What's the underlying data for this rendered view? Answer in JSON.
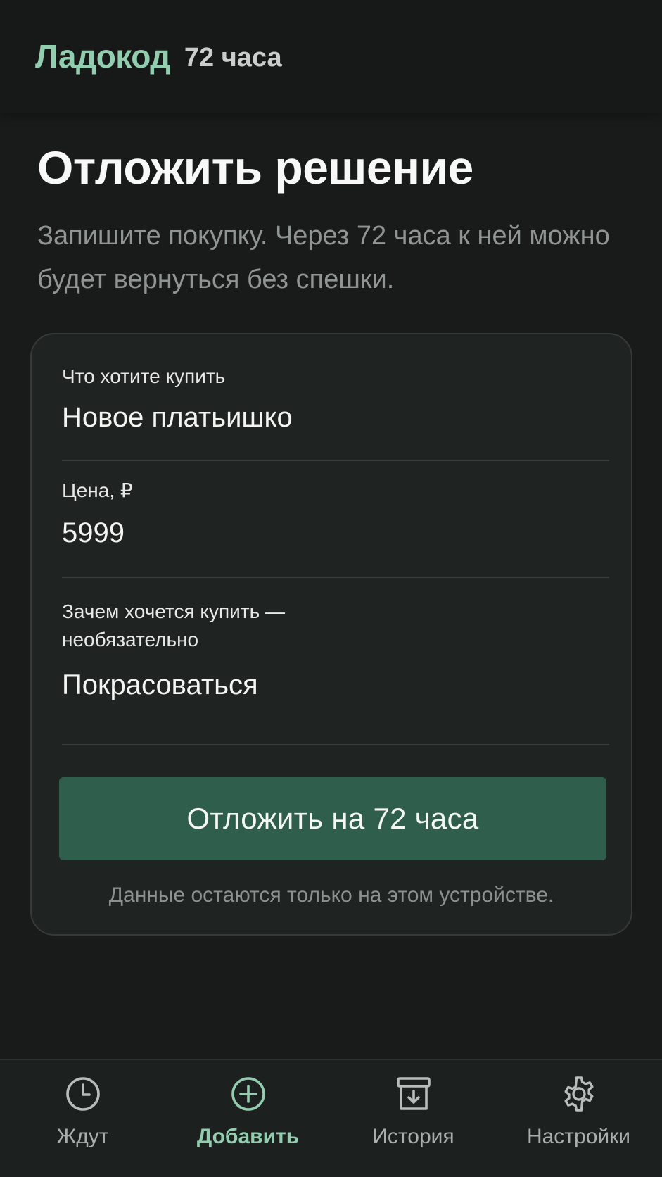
{
  "header": {
    "brand": "Ладокод",
    "subtitle": "72 часа"
  },
  "main": {
    "title": "Отложить решение",
    "subtitle": "Запишите покупку. Через 72 часа к ней можно будет вернуться без спешки."
  },
  "form": {
    "item": {
      "label": "Что хотите купить",
      "value": "Новое платьишко"
    },
    "price": {
      "label": "Цена, ₽",
      "value": "5999"
    },
    "reason": {
      "label": "Зачем хочется купить — необязательно",
      "value": "Покрасоваться"
    },
    "submit_label": "Отложить на 72 часа",
    "privacy_note": "Данные остаются только на этом устройстве."
  },
  "nav": {
    "items": [
      {
        "label": "Ждут",
        "icon": "clock-icon",
        "active": false
      },
      {
        "label": "Добавить",
        "icon": "plus-circle-icon",
        "active": true
      },
      {
        "label": "История",
        "icon": "archive-icon",
        "active": false
      },
      {
        "label": "Настройки",
        "icon": "gear-icon",
        "active": false
      }
    ]
  },
  "colors": {
    "accent": "#93cdb0",
    "button": "#2f5e4c",
    "background": "#191b1a",
    "card": "#1f2321"
  }
}
